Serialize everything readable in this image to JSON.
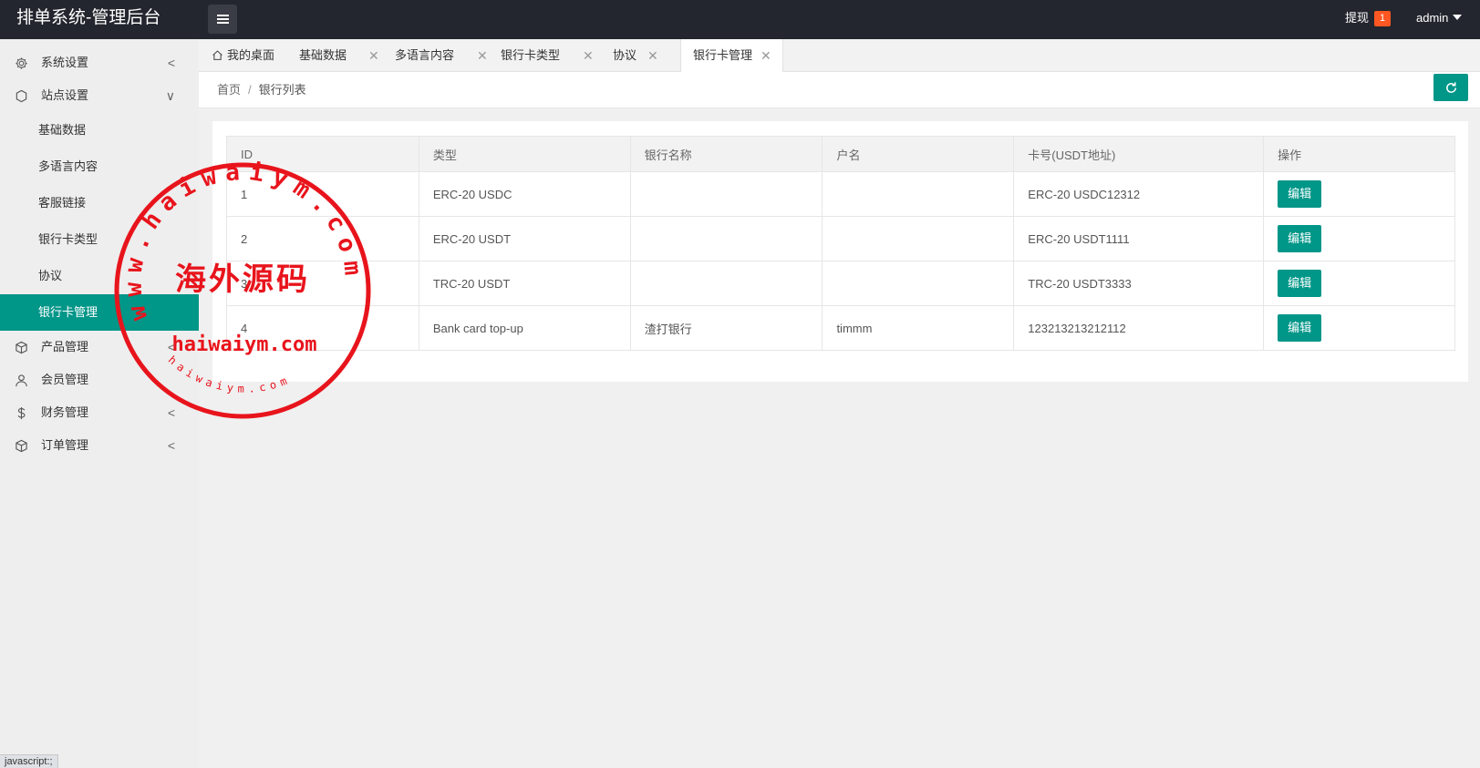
{
  "app": {
    "title": "排单系统-管理后台"
  },
  "header": {
    "withdraw_label": "提现",
    "withdraw_count": "1",
    "user_name": "admin"
  },
  "sidebar": {
    "items": [
      {
        "label": "系统设置",
        "icon": "gear-icon",
        "chevron": "<"
      },
      {
        "label": "站点设置",
        "icon": "shield-icon",
        "chevron": "∨"
      },
      {
        "label": "产品管理",
        "icon": "box-icon",
        "chevron": "<"
      },
      {
        "label": "会员管理",
        "icon": "user-icon",
        "chevron": ""
      },
      {
        "label": "财务管理",
        "icon": "dollar-icon",
        "chevron": "<"
      },
      {
        "label": "订单管理",
        "icon": "cube-icon",
        "chevron": "<"
      }
    ],
    "sub_items": [
      {
        "label": "基础数据"
      },
      {
        "label": "多语言内容"
      },
      {
        "label": "客服链接"
      },
      {
        "label": "银行卡类型"
      },
      {
        "label": "协议"
      },
      {
        "label": "银行卡管理"
      }
    ]
  },
  "status_hint": "javascript:;",
  "tabs": [
    {
      "label": "我的桌面",
      "icon": "home-icon",
      "closable": false
    },
    {
      "label": "基础数据",
      "closable": true
    },
    {
      "label": "多语言内容",
      "closable": true
    },
    {
      "label": "银行卡类型",
      "closable": true
    },
    {
      "label": "协议",
      "closable": true
    },
    {
      "label": "银行卡管理",
      "closable": true,
      "active": true
    }
  ],
  "close_glyph": "✕",
  "breadcrumb": {
    "home": "首页",
    "separator": "/",
    "current": "银行列表"
  },
  "table": {
    "headers": [
      "ID",
      "类型",
      "银行名称",
      "户名",
      "卡号(USDT地址)",
      "操作"
    ],
    "rows": [
      {
        "id": "1",
        "type": "ERC-20 USDC",
        "bank": "",
        "name": "",
        "card": "ERC-20 USDC12312",
        "action": "编辑"
      },
      {
        "id": "2",
        "type": "ERC-20 USDT",
        "bank": "",
        "name": "",
        "card": "ERC-20 USDT1111",
        "action": "编辑"
      },
      {
        "id": "3",
        "type": "TRC-20 USDT",
        "bank": "",
        "name": "",
        "card": "TRC-20 USDT3333",
        "action": "编辑"
      },
      {
        "id": "4",
        "type": "Bank card top-up",
        "bank": "渣打银行",
        "name": "timmm",
        "card": "123213213212112",
        "action": "编辑"
      }
    ]
  },
  "watermark": {
    "arc_text": "www.haiwaiym.com",
    "center_text": "海外源码",
    "bottom_text": "haiwaiym.com",
    "small_arc_text": "haiwaiym.com",
    "color": "#e8141c"
  },
  "colors": {
    "header_bg": "#23262e",
    "accent": "#009688",
    "badge": "#ff5722"
  }
}
